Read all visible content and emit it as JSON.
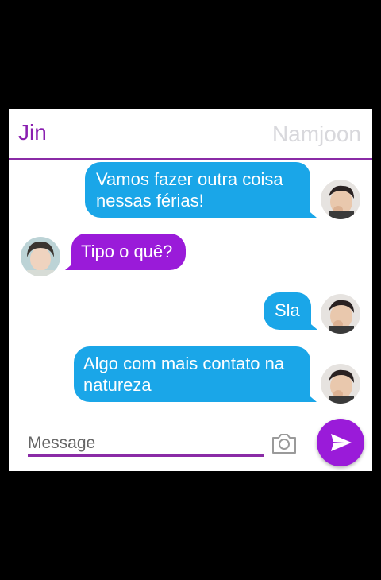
{
  "header": {
    "contact_left": "Jin",
    "contact_right": "Namjoon"
  },
  "messages": [
    {
      "side": "right",
      "sender": "Namjoon",
      "line1": "Vamos fazer outra coisa",
      "line2": "nessas férias!"
    },
    {
      "side": "left",
      "sender": "Jin",
      "line1": "Tipo o quê?"
    },
    {
      "side": "right",
      "sender": "Namjoon",
      "line1": "Sla"
    },
    {
      "side": "right",
      "sender": "Namjoon",
      "line1": "Algo com mais contato na",
      "line2": "natureza"
    }
  ],
  "composer": {
    "placeholder": "Message",
    "camera_icon": "camera-icon",
    "send_icon": "send-icon"
  },
  "colors": {
    "accent_purple": "#9a1bd9",
    "bubble_blue": "#1aa6e8",
    "header_line": "#8a2ba6"
  }
}
